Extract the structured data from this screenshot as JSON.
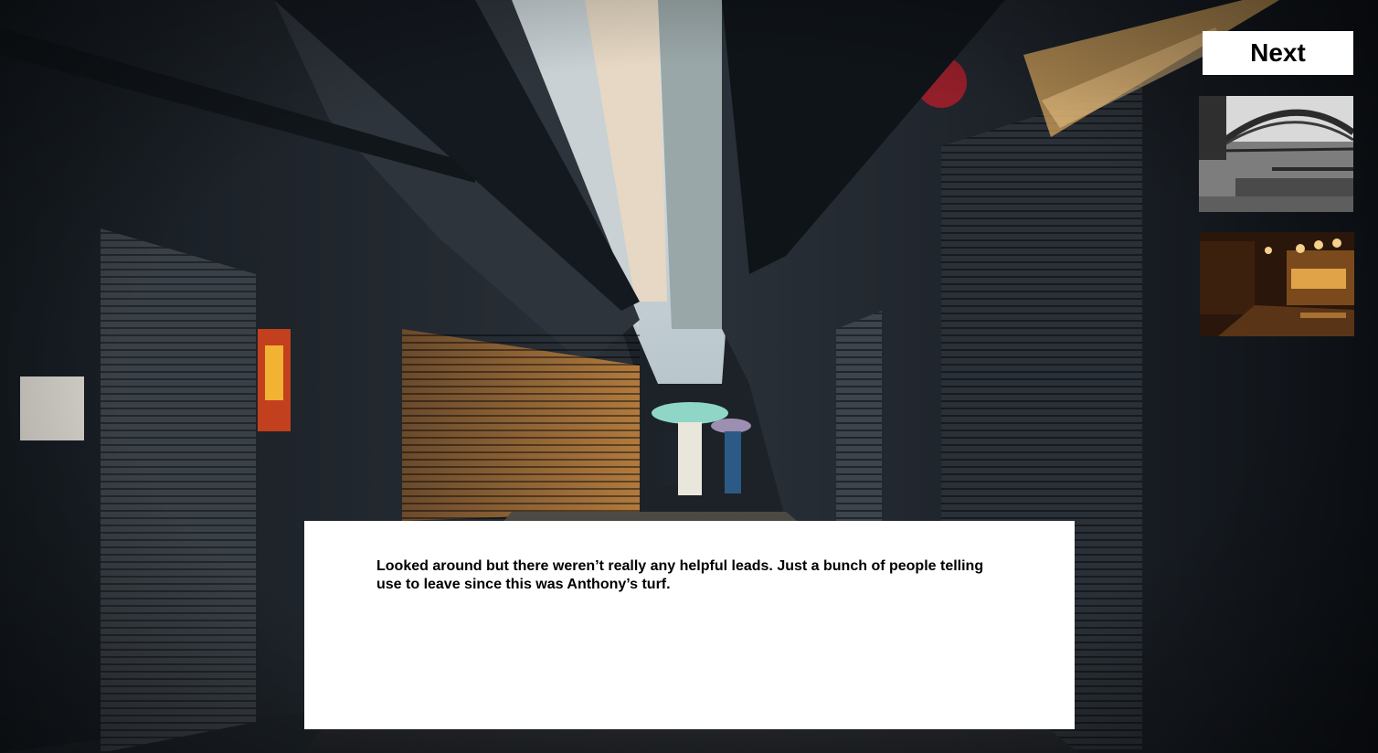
{
  "navigation": {
    "next_label": "Next"
  },
  "dialogue": {
    "text": "Looked around but there weren’t really any helpful leads. Just a bunch of people telling use to leave since this was Anthony’s turf."
  },
  "thumbnails": [
    {
      "subject": "harbour-bridge-photo"
    },
    {
      "subject": "night-street-photo"
    }
  ],
  "colors": {
    "dialogue_background": "#ffffff",
    "button_background": "#ffffff",
    "text": "#000000"
  }
}
